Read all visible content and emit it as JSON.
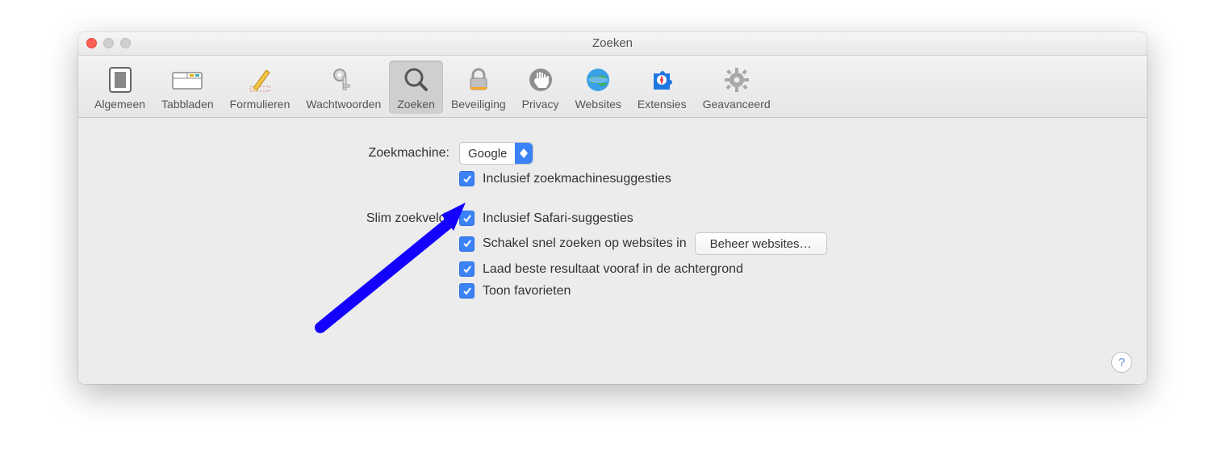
{
  "window": {
    "title": "Zoeken"
  },
  "toolbar": {
    "items": [
      {
        "id": "general",
        "label": "Algemeen"
      },
      {
        "id": "tabs",
        "label": "Tabbladen"
      },
      {
        "id": "forms",
        "label": "Formulieren"
      },
      {
        "id": "passwords",
        "label": "Wachtwoorden"
      },
      {
        "id": "search",
        "label": "Zoeken"
      },
      {
        "id": "security",
        "label": "Beveiliging"
      },
      {
        "id": "privacy",
        "label": "Privacy"
      },
      {
        "id": "websites",
        "label": "Websites"
      },
      {
        "id": "extensions",
        "label": "Extensies"
      },
      {
        "id": "advanced",
        "label": "Geavanceerd"
      }
    ],
    "selected": "search"
  },
  "search": {
    "engine_label": "Zoekmachine:",
    "engine_value": "Google",
    "include_suggestions": "Inclusief zoekmachinesuggesties",
    "smartfield_label": "Slim zoekveld:",
    "safari_suggestions": "Inclusief Safari-suggesties",
    "quick_website_search": "Schakel snel zoeken op websites in",
    "manage_websites_button": "Beheer websites…",
    "preload_top_hit": "Laad beste resultaat vooraf in de achtergrond",
    "show_favorites": "Toon favorieten"
  },
  "help_symbol": "?"
}
